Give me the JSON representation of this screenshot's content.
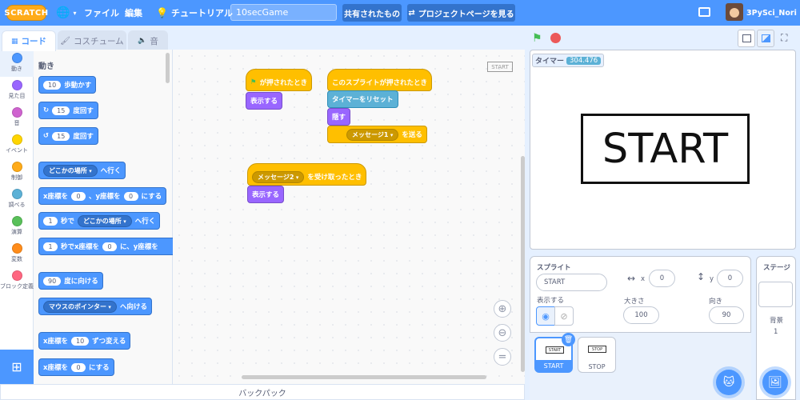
{
  "menu": {
    "logo": "SCRATCH",
    "file": "ファイル",
    "edit": "編集",
    "tutorial": "チュートリアル",
    "project_title": "10secGame",
    "shared": "共有されたもの",
    "project_page": "プロジェクトページを見る",
    "username": "3PySci_Nori"
  },
  "tabs": {
    "code": "コード",
    "costume": "コスチューム",
    "sound": "音"
  },
  "categories": [
    {
      "label": "動き",
      "color": "#4c97ff"
    },
    {
      "label": "見た目",
      "color": "#9966ff"
    },
    {
      "label": "音",
      "color": "#cf63cf"
    },
    {
      "label": "イベント",
      "color": "#ffd500"
    },
    {
      "label": "制御",
      "color": "#ffab19"
    },
    {
      "label": "調べる",
      "color": "#5cb1d6"
    },
    {
      "label": "演算",
      "color": "#59c059"
    },
    {
      "label": "変数",
      "color": "#ff8c1a"
    },
    {
      "label": "ブロック定義",
      "color": "#ff6680"
    }
  ],
  "palette": {
    "title": "動き",
    "move_steps": {
      "num": "10",
      "text": "歩動かす"
    },
    "turn_right": {
      "num": "15",
      "text": "度回す"
    },
    "turn_left": {
      "num": "15",
      "text": "度回す"
    },
    "goto": {
      "menu": "どこかの場所",
      "text": "へ行く"
    },
    "goto_xy": {
      "t1": "x座標を",
      "x": "0",
      "t2": "、y座標を",
      "y": "0",
      "t3": "にする"
    },
    "glide": {
      "num": "1",
      "t1": "秒で",
      "menu": "どこかの場所",
      "t2": "へ行く"
    },
    "glide_xy": {
      "num": "1",
      "t1": "秒でx座標を",
      "x": "0",
      "t2": "に、y座標を"
    },
    "point_dir": {
      "num": "90",
      "text": "度に向ける"
    },
    "point_towards": {
      "menu": "マウスのポインター",
      "text": "へ向ける"
    },
    "change_x": {
      "t1": "x座標を",
      "num": "10",
      "t2": "ずつ変える"
    },
    "set_x": {
      "t1": "x座標を",
      "num": "0",
      "t2": "にする"
    }
  },
  "scripts": {
    "corner_label": "START",
    "flag_hat": "が押されたとき",
    "show1": "表示する",
    "sprite_clicked": "このスプライトが押されたとき",
    "reset_timer": "タイマーをリセット",
    "hide": "隠す",
    "broadcast_menu": "メッセージ1",
    "broadcast_text": "を送る",
    "receive_menu": "メッセージ2",
    "receive_text": "を受け取ったとき",
    "show2": "表示する"
  },
  "backpack": "バックパック",
  "stage": {
    "monitor_label": "タイマー",
    "monitor_value": "304.476",
    "text": "START"
  },
  "sprite_info": {
    "sprite_label": "スプライト",
    "sprite_name": "START",
    "x_label": "x",
    "x": "0",
    "y_label": "y",
    "y": "0",
    "show_label": "表示する",
    "size_label": "大きさ",
    "size": "100",
    "dir_label": "向き",
    "direction": "90"
  },
  "sprites": [
    {
      "name": "START",
      "thumb": "START"
    },
    {
      "name": "STOP",
      "thumb": "STOP"
    }
  ],
  "stage_pane": {
    "title": "ステージ",
    "backdrops_label": "背景",
    "backdrops_count": "1"
  }
}
